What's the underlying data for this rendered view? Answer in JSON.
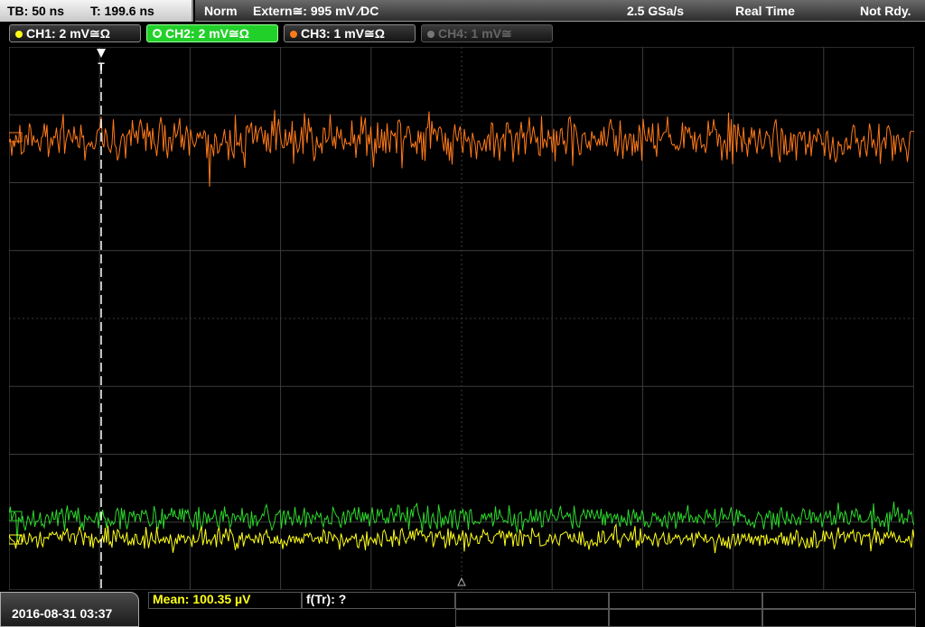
{
  "header": {
    "timebase": "TB: 50 ns",
    "trigger_time": "T: 199.6 ns",
    "mode": "Norm",
    "trigger": "Extern≅: 995 mV ∕DC",
    "sample_rate": "2.5 GSa/s",
    "acq": "Real Time",
    "status": "Not Rdy."
  },
  "channels": [
    {
      "label": "CH1: 2 mV≅Ω",
      "color": "#ffff1a",
      "state": "on"
    },
    {
      "label": "CH2: 2 mV≅Ω",
      "color": "#2cd82c",
      "state": "selected"
    },
    {
      "label": "CH3: 1 mV≅Ω",
      "color": "#ff7a1a",
      "state": "on"
    },
    {
      "label": "CH4: 1 mV≅",
      "color": "#777777",
      "state": "off"
    }
  ],
  "trigger_marker": "T",
  "footer": {
    "datetime": "2016-08-31 03:37",
    "measure_1": "Mean: 100.35 µV",
    "measure_2": "f(Tr): ?"
  },
  "colors": {
    "ch1": "#ffff1a",
    "ch2": "#2cd82c",
    "ch3": "#ff7a1a",
    "grid": "#3c3c3c",
    "measure_text": "#ffff1a"
  }
}
